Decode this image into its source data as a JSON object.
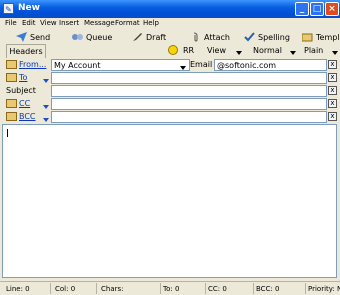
{
  "window": {
    "title": "New"
  },
  "menu": [
    "File",
    "Edit",
    "View",
    "Insert",
    "Message",
    "Format",
    "Help"
  ],
  "toolbar": {
    "send": "Send",
    "queue": "Queue",
    "draft": "Draft",
    "attach": "Attach",
    "spelling": "Spelling",
    "templates": "Templ"
  },
  "headers_bar": {
    "tab": "Headers",
    "rr": "RR",
    "view": "View",
    "priority": "Normal",
    "format": "Plain"
  },
  "rows": {
    "from": {
      "label": "From...",
      "account": "My Account",
      "email_label": "Email",
      "email": "@softonic.com"
    },
    "to": {
      "label": "To"
    },
    "subject": {
      "label": "Subject"
    },
    "cc": {
      "label": "CC"
    },
    "bcc": {
      "label": "BCC"
    }
  },
  "status": {
    "line": "Line: 0",
    "col": "Col: 0",
    "chars": "Chars:",
    "to": "To: 0",
    "cc": "CC: 0",
    "bcc": "BCC: 0",
    "priority": "Priority: N"
  },
  "colors": {
    "title_bar": "#0a5fe0",
    "link": "#0b37b8"
  }
}
